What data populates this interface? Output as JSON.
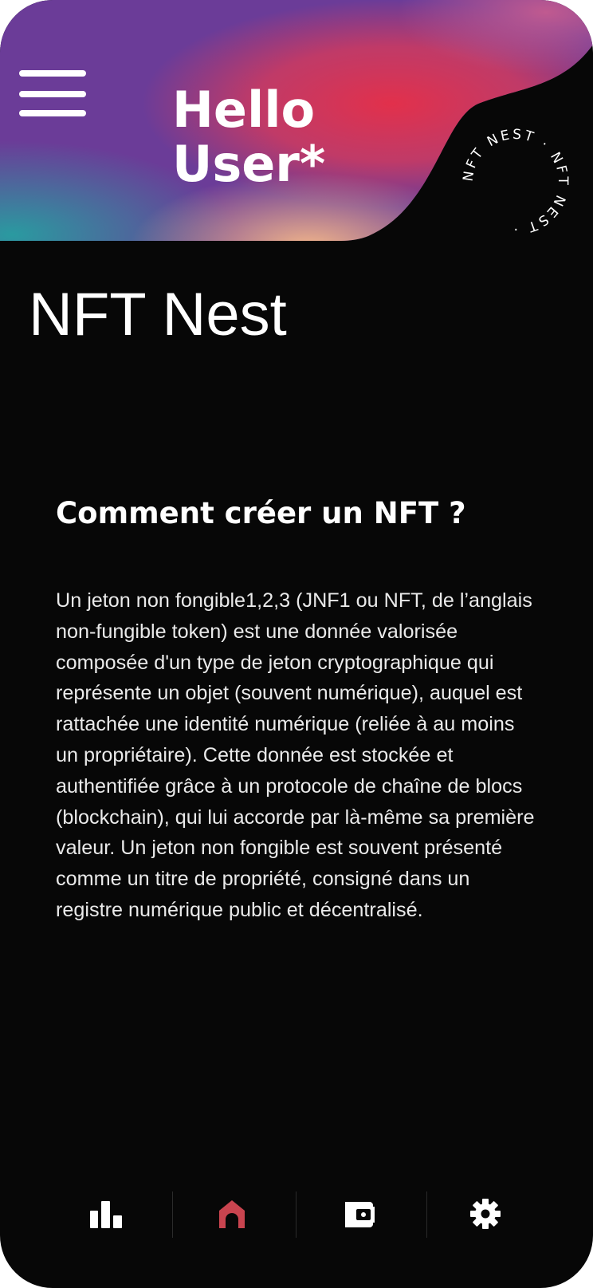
{
  "header": {
    "greeting_line1": "Hello",
    "greeting_line2": "User*",
    "badge_text": "NFT NEST · NFT NEST · ",
    "menu_icon": "hamburger-menu-icon",
    "colors": {
      "gradient_purple": "#6a3a9a",
      "gradient_red": "#e0304a",
      "gradient_teal": "#2f8f9a",
      "gradient_orange": "#e8a070"
    }
  },
  "app": {
    "title": "NFT Nest"
  },
  "section": {
    "heading": "Comment créer un NFT ?",
    "body": "Un jeton non fongible1,2,3 (JNF1 ou NFT, de l’anglais non-fungible token) est une donnée valorisée composée d'un type de jeton cryptographique qui représente un objet (souvent numérique), auquel est rattachée une identité numérique (reliée à au moins un propriétaire). Cette donnée est stockée et authentifiée grâce à un protocole de chaîne de blocs (blockchain), qui lui accorde par là-même sa première valeur. Un jeton non fongible est souvent présenté comme un titre de propriété, consigné dans un registre numérique public et décentralisé."
  },
  "tabbar": {
    "tabs": [
      {
        "icon": "bar-chart-icon",
        "active": false
      },
      {
        "icon": "home-icon",
        "active": true
      },
      {
        "icon": "wallet-icon",
        "active": false
      },
      {
        "icon": "gear-icon",
        "active": false
      }
    ],
    "active_color": "#c9444f",
    "inactive_color": "#ffffff"
  }
}
